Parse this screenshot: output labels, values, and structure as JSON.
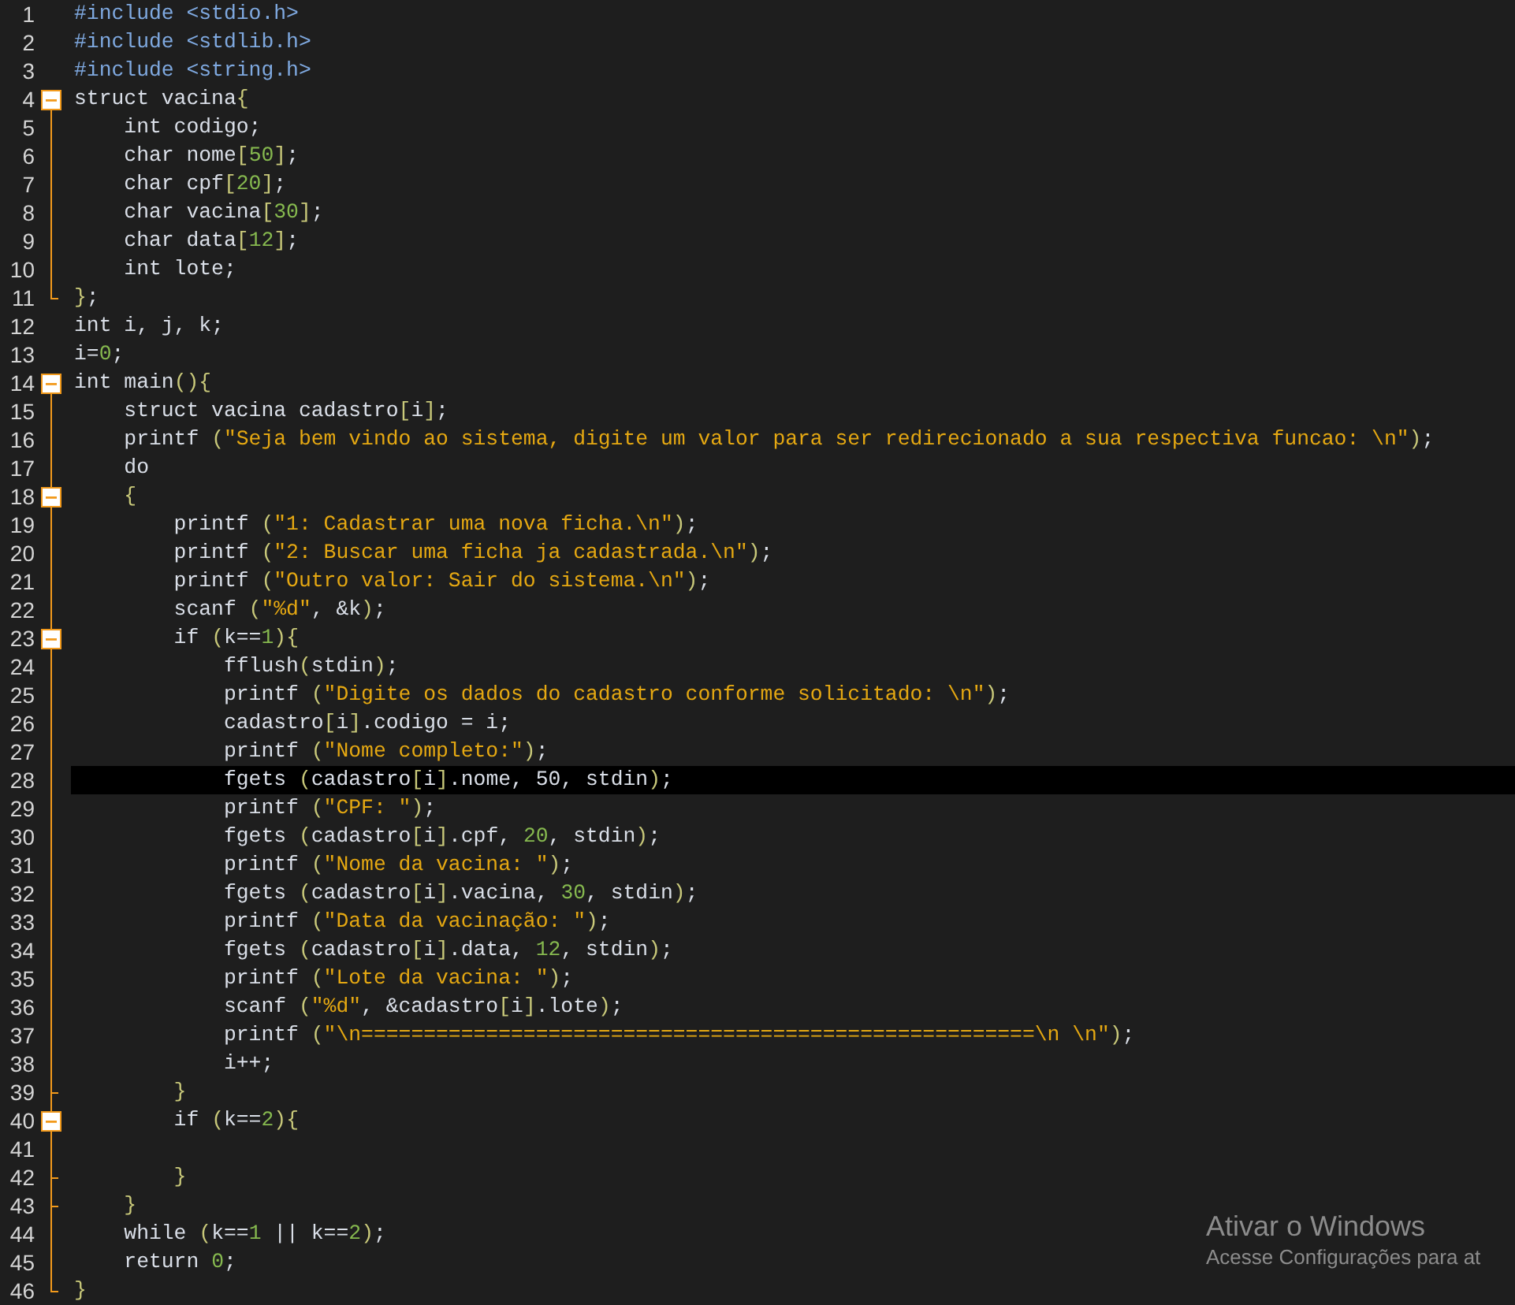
{
  "editor": {
    "lines": [
      {
        "number": "1",
        "current": false,
        "tokens": [
          {
            "kind": "pp",
            "text": "#include <stdio.h>"
          }
        ]
      },
      {
        "number": "2",
        "current": false,
        "tokens": [
          {
            "kind": "pp",
            "text": "#include <stdlib.h>"
          }
        ]
      },
      {
        "number": "3",
        "current": false,
        "tokens": [
          {
            "kind": "pp",
            "text": "#include <string.h>"
          }
        ]
      },
      {
        "number": "4",
        "current": false,
        "expanded": true,
        "tokens": [
          {
            "kind": "plain",
            "text": "struct vacina"
          },
          {
            "kind": "br",
            "text": "{"
          }
        ]
      },
      {
        "number": "5",
        "current": false,
        "tokens": [
          {
            "kind": "plain",
            "text": "    int codigo;"
          }
        ]
      },
      {
        "number": "6",
        "current": false,
        "tokens": [
          {
            "kind": "plain",
            "text": "    char nome"
          },
          {
            "kind": "br",
            "text": "["
          },
          {
            "kind": "num",
            "text": "50"
          },
          {
            "kind": "br",
            "text": "]"
          },
          {
            "kind": "plain",
            "text": ";"
          }
        ]
      },
      {
        "number": "7",
        "current": false,
        "tokens": [
          {
            "kind": "plain",
            "text": "    char cpf"
          },
          {
            "kind": "br",
            "text": "["
          },
          {
            "kind": "num",
            "text": "20"
          },
          {
            "kind": "br",
            "text": "]"
          },
          {
            "kind": "plain",
            "text": ";"
          }
        ]
      },
      {
        "number": "8",
        "current": false,
        "tokens": [
          {
            "kind": "plain",
            "text": "    char vacina"
          },
          {
            "kind": "br",
            "text": "["
          },
          {
            "kind": "num",
            "text": "30"
          },
          {
            "kind": "br",
            "text": "]"
          },
          {
            "kind": "plain",
            "text": ";"
          }
        ]
      },
      {
        "number": "9",
        "current": false,
        "tokens": [
          {
            "kind": "plain",
            "text": "    char data"
          },
          {
            "kind": "br",
            "text": "["
          },
          {
            "kind": "num",
            "text": "12"
          },
          {
            "kind": "br",
            "text": "]"
          },
          {
            "kind": "plain",
            "text": ";"
          }
        ]
      },
      {
        "number": "10",
        "current": false,
        "tokens": [
          {
            "kind": "plain",
            "text": "    int lote;"
          }
        ]
      },
      {
        "number": "11",
        "current": false,
        "block_end": true,
        "tokens": [
          {
            "kind": "br",
            "text": "}"
          },
          {
            "kind": "plain",
            "text": ";"
          }
        ]
      },
      {
        "number": "12",
        "current": false,
        "tokens": [
          {
            "kind": "plain",
            "text": "int i, j, k;"
          }
        ]
      },
      {
        "number": "13",
        "current": false,
        "tokens": [
          {
            "kind": "plain",
            "text": "i="
          },
          {
            "kind": "num",
            "text": "0"
          },
          {
            "kind": "plain",
            "text": ";"
          }
        ]
      },
      {
        "number": "14",
        "current": false,
        "expanded": true,
        "tokens": [
          {
            "kind": "plain",
            "text": "int main"
          },
          {
            "kind": "br",
            "text": "(){"
          }
        ]
      },
      {
        "number": "15",
        "current": false,
        "tokens": [
          {
            "kind": "plain",
            "text": "    struct vacina cadastro"
          },
          {
            "kind": "br",
            "text": "["
          },
          {
            "kind": "plain",
            "text": "i"
          },
          {
            "kind": "br",
            "text": "]"
          },
          {
            "kind": "plain",
            "text": ";"
          }
        ]
      },
      {
        "number": "16",
        "current": false,
        "tokens": [
          {
            "kind": "plain",
            "text": "    printf "
          },
          {
            "kind": "br",
            "text": "("
          },
          {
            "kind": "str",
            "text": "\"Seja bem vindo ao sistema, digite um valor para ser redirecionado a sua respectiva funcao: \\n\""
          },
          {
            "kind": "br",
            "text": ")"
          },
          {
            "kind": "plain",
            "text": ";"
          }
        ]
      },
      {
        "number": "17",
        "current": false,
        "tokens": [
          {
            "kind": "plain",
            "text": "    do"
          }
        ]
      },
      {
        "number": "18",
        "current": false,
        "expanded": true,
        "tokens": [
          {
            "kind": "br",
            "text": "    {"
          }
        ]
      },
      {
        "number": "19",
        "current": false,
        "tokens": [
          {
            "kind": "plain",
            "text": "        printf "
          },
          {
            "kind": "br",
            "text": "("
          },
          {
            "kind": "str",
            "text": "\"1: Cadastrar uma nova ficha.\\n\""
          },
          {
            "kind": "br",
            "text": ")"
          },
          {
            "kind": "plain",
            "text": ";"
          }
        ]
      },
      {
        "number": "20",
        "current": false,
        "tokens": [
          {
            "kind": "plain",
            "text": "        printf "
          },
          {
            "kind": "br",
            "text": "("
          },
          {
            "kind": "str",
            "text": "\"2: Buscar uma ficha ja cadastrada.\\n\""
          },
          {
            "kind": "br",
            "text": ")"
          },
          {
            "kind": "plain",
            "text": ";"
          }
        ]
      },
      {
        "number": "21",
        "current": false,
        "tokens": [
          {
            "kind": "plain",
            "text": "        printf "
          },
          {
            "kind": "br",
            "text": "("
          },
          {
            "kind": "str",
            "text": "\"Outro valor: Sair do sistema.\\n\""
          },
          {
            "kind": "br",
            "text": ")"
          },
          {
            "kind": "plain",
            "text": ";"
          }
        ]
      },
      {
        "number": "22",
        "current": false,
        "tokens": [
          {
            "kind": "plain",
            "text": "        scanf "
          },
          {
            "kind": "br",
            "text": "("
          },
          {
            "kind": "str",
            "text": "\"%d\""
          },
          {
            "kind": "plain",
            "text": ", &k"
          },
          {
            "kind": "br",
            "text": ")"
          },
          {
            "kind": "plain",
            "text": ";"
          }
        ]
      },
      {
        "number": "23",
        "current": false,
        "expanded": true,
        "tokens": [
          {
            "kind": "plain",
            "text": "        if "
          },
          {
            "kind": "br",
            "text": "("
          },
          {
            "kind": "plain",
            "text": "k=="
          },
          {
            "kind": "num",
            "text": "1"
          },
          {
            "kind": "br",
            "text": "){"
          }
        ]
      },
      {
        "number": "24",
        "current": false,
        "tokens": [
          {
            "kind": "plain",
            "text": "            fflush"
          },
          {
            "kind": "br",
            "text": "("
          },
          {
            "kind": "plain",
            "text": "stdin"
          },
          {
            "kind": "br",
            "text": ")"
          },
          {
            "kind": "plain",
            "text": ";"
          }
        ]
      },
      {
        "number": "25",
        "current": false,
        "tokens": [
          {
            "kind": "plain",
            "text": "            printf "
          },
          {
            "kind": "br",
            "text": "("
          },
          {
            "kind": "str",
            "text": "\"Digite os dados do cadastro conforme solicitado: \\n\""
          },
          {
            "kind": "br",
            "text": ")"
          },
          {
            "kind": "plain",
            "text": ";"
          }
        ]
      },
      {
        "number": "26",
        "current": false,
        "tokens": [
          {
            "kind": "plain",
            "text": "            cadastro"
          },
          {
            "kind": "br",
            "text": "["
          },
          {
            "kind": "plain",
            "text": "i"
          },
          {
            "kind": "br",
            "text": "]"
          },
          {
            "kind": "plain",
            "text": ".codigo = i;"
          }
        ]
      },
      {
        "number": "27",
        "current": false,
        "tokens": [
          {
            "kind": "plain",
            "text": "            printf "
          },
          {
            "kind": "br",
            "text": "("
          },
          {
            "kind": "str",
            "text": "\"Nome completo:\""
          },
          {
            "kind": "br",
            "text": ")"
          },
          {
            "kind": "plain",
            "text": ";"
          }
        ]
      },
      {
        "number": "28",
        "current": true,
        "tokens": [
          {
            "kind": "plain",
            "text": "            fgets "
          },
          {
            "kind": "br",
            "text": "("
          },
          {
            "kind": "plain",
            "text": "cadastro"
          },
          {
            "kind": "br",
            "text": "["
          },
          {
            "kind": "plain",
            "text": "i"
          },
          {
            "kind": "br",
            "text": "]"
          },
          {
            "kind": "plain",
            "text": ".nome, 50, stdin"
          },
          {
            "kind": "br",
            "text": ")"
          },
          {
            "kind": "plain",
            "text": ";"
          }
        ]
      },
      {
        "number": "29",
        "current": false,
        "tokens": [
          {
            "kind": "plain",
            "text": "            printf "
          },
          {
            "kind": "br",
            "text": "("
          },
          {
            "kind": "str",
            "text": "\"CPF: \""
          },
          {
            "kind": "br",
            "text": ")"
          },
          {
            "kind": "plain",
            "text": ";"
          }
        ]
      },
      {
        "number": "30",
        "current": false,
        "tokens": [
          {
            "kind": "plain",
            "text": "            fgets "
          },
          {
            "kind": "br",
            "text": "("
          },
          {
            "kind": "plain",
            "text": "cadastro"
          },
          {
            "kind": "br",
            "text": "["
          },
          {
            "kind": "plain",
            "text": "i"
          },
          {
            "kind": "br",
            "text": "]"
          },
          {
            "kind": "plain",
            "text": ".cpf, "
          },
          {
            "kind": "num",
            "text": "20"
          },
          {
            "kind": "plain",
            "text": ", stdin"
          },
          {
            "kind": "br",
            "text": ")"
          },
          {
            "kind": "plain",
            "text": ";"
          }
        ]
      },
      {
        "number": "31",
        "current": false,
        "tokens": [
          {
            "kind": "plain",
            "text": "            printf "
          },
          {
            "kind": "br",
            "text": "("
          },
          {
            "kind": "str",
            "text": "\"Nome da vacina: \""
          },
          {
            "kind": "br",
            "text": ")"
          },
          {
            "kind": "plain",
            "text": ";"
          }
        ]
      },
      {
        "number": "32",
        "current": false,
        "tokens": [
          {
            "kind": "plain",
            "text": "            fgets "
          },
          {
            "kind": "br",
            "text": "("
          },
          {
            "kind": "plain",
            "text": "cadastro"
          },
          {
            "kind": "br",
            "text": "["
          },
          {
            "kind": "plain",
            "text": "i"
          },
          {
            "kind": "br",
            "text": "]"
          },
          {
            "kind": "plain",
            "text": ".vacina, "
          },
          {
            "kind": "num",
            "text": "30"
          },
          {
            "kind": "plain",
            "text": ", stdin"
          },
          {
            "kind": "br",
            "text": ")"
          },
          {
            "kind": "plain",
            "text": ";"
          }
        ]
      },
      {
        "number": "33",
        "current": false,
        "tokens": [
          {
            "kind": "plain",
            "text": "            printf "
          },
          {
            "kind": "br",
            "text": "("
          },
          {
            "kind": "str",
            "text": "\"Data da vacinação: \""
          },
          {
            "kind": "br",
            "text": ")"
          },
          {
            "kind": "plain",
            "text": ";"
          }
        ]
      },
      {
        "number": "34",
        "current": false,
        "tokens": [
          {
            "kind": "plain",
            "text": "            fgets "
          },
          {
            "kind": "br",
            "text": "("
          },
          {
            "kind": "plain",
            "text": "cadastro"
          },
          {
            "kind": "br",
            "text": "["
          },
          {
            "kind": "plain",
            "text": "i"
          },
          {
            "kind": "br",
            "text": "]"
          },
          {
            "kind": "plain",
            "text": ".data, "
          },
          {
            "kind": "num",
            "text": "12"
          },
          {
            "kind": "plain",
            "text": ", stdin"
          },
          {
            "kind": "br",
            "text": ")"
          },
          {
            "kind": "plain",
            "text": ";"
          }
        ]
      },
      {
        "number": "35",
        "current": false,
        "tokens": [
          {
            "kind": "plain",
            "text": "            printf "
          },
          {
            "kind": "br",
            "text": "("
          },
          {
            "kind": "str",
            "text": "\"Lote da vacina: \""
          },
          {
            "kind": "br",
            "text": ")"
          },
          {
            "kind": "plain",
            "text": ";"
          }
        ]
      },
      {
        "number": "36",
        "current": false,
        "tokens": [
          {
            "kind": "plain",
            "text": "            scanf "
          },
          {
            "kind": "br",
            "text": "("
          },
          {
            "kind": "str",
            "text": "\"%d\""
          },
          {
            "kind": "plain",
            "text": ", &cadastro"
          },
          {
            "kind": "br",
            "text": "["
          },
          {
            "kind": "plain",
            "text": "i"
          },
          {
            "kind": "br",
            "text": "]"
          },
          {
            "kind": "plain",
            "text": ".lote"
          },
          {
            "kind": "br",
            "text": ")"
          },
          {
            "kind": "plain",
            "text": ";"
          }
        ]
      },
      {
        "number": "37",
        "current": false,
        "tokens": [
          {
            "kind": "plain",
            "text": "            printf "
          },
          {
            "kind": "br",
            "text": "("
          },
          {
            "kind": "str",
            "text": "\"\\n======================================================\\n \\n\""
          },
          {
            "kind": "br",
            "text": ")"
          },
          {
            "kind": "plain",
            "text": ";"
          }
        ]
      },
      {
        "number": "38",
        "current": false,
        "tokens": [
          {
            "kind": "plain",
            "text": "            i++;"
          }
        ]
      },
      {
        "number": "39",
        "current": false,
        "block_end": true,
        "tokens": [
          {
            "kind": "br",
            "text": "        }"
          }
        ]
      },
      {
        "number": "40",
        "current": false,
        "expanded": true,
        "tokens": [
          {
            "kind": "plain",
            "text": "        if "
          },
          {
            "kind": "br",
            "text": "("
          },
          {
            "kind": "plain",
            "text": "k=="
          },
          {
            "kind": "num",
            "text": "2"
          },
          {
            "kind": "br",
            "text": "){"
          }
        ]
      },
      {
        "number": "41",
        "current": false
      },
      {
        "number": "42",
        "current": false,
        "block_end": true,
        "tokens": [
          {
            "kind": "br",
            "text": "        }"
          }
        ]
      },
      {
        "number": "43",
        "current": false,
        "block_end": true,
        "tokens": [
          {
            "kind": "br",
            "text": "    }"
          }
        ]
      },
      {
        "number": "44",
        "current": false,
        "tokens": [
          {
            "kind": "plain",
            "text": "    while "
          },
          {
            "kind": "br",
            "text": "("
          },
          {
            "kind": "plain",
            "text": "k=="
          },
          {
            "kind": "num",
            "text": "1"
          },
          {
            "kind": "plain",
            "text": " || k=="
          },
          {
            "kind": "num",
            "text": "2"
          },
          {
            "kind": "br",
            "text": ")"
          },
          {
            "kind": "plain",
            "text": ";"
          }
        ]
      },
      {
        "number": "45",
        "current": false,
        "tokens": [
          {
            "kind": "plain",
            "text": "    return "
          },
          {
            "kind": "num",
            "text": "0"
          },
          {
            "kind": "plain",
            "text": ";"
          }
        ]
      },
      {
        "number": "46",
        "current": false,
        "block_end": true,
        "tokens": [
          {
            "kind": "br",
            "text": "}"
          }
        ]
      }
    ]
  },
  "activation_notice": {
    "title": "Ativar o Windows",
    "text": "Acesse Configurações para at"
  }
}
